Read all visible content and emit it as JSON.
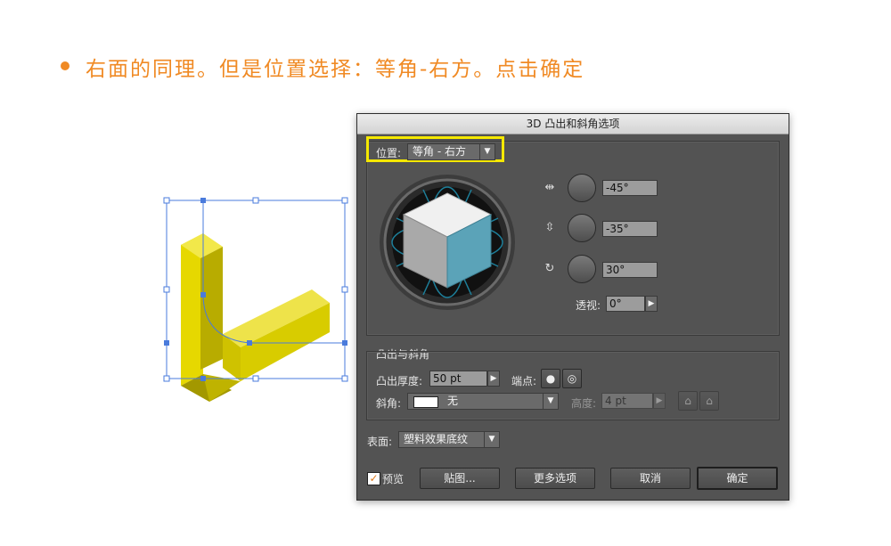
{
  "heading": {
    "text": "右面的同理。但是位置选择：等角-右方。点击确定"
  },
  "colors": {
    "accent": "#f08a24",
    "highlight": "#f5e800",
    "cube_right": "#5ba3b8",
    "object_yellow": "#e0d000"
  },
  "dialog": {
    "title": "3D 凸出和斜角选项",
    "position": {
      "label": "位置:",
      "value": "等角 - 右方"
    },
    "rotation": {
      "x": {
        "icon": "rotate-x-icon",
        "value": "-45°"
      },
      "y": {
        "icon": "rotate-y-icon",
        "value": "-35°"
      },
      "z": {
        "icon": "rotate-z-icon",
        "value": "30°"
      }
    },
    "perspective": {
      "label": "透视:",
      "value": "0°"
    },
    "extrude": {
      "section_title": "凸出与斜角",
      "depth_label": "凸出厚度:",
      "depth_value": "50 pt",
      "cap_label": "端点:",
      "bevel_label": "斜角:",
      "bevel_value": "无",
      "height_label": "高度:",
      "height_value": "4 pt"
    },
    "surface": {
      "label": "表面:",
      "value": "塑料效果底纹"
    },
    "buttons": {
      "preview": "预览",
      "preview_checked": true,
      "map": "贴图...",
      "more": "更多选项",
      "cancel": "取消",
      "ok": "确定"
    }
  }
}
